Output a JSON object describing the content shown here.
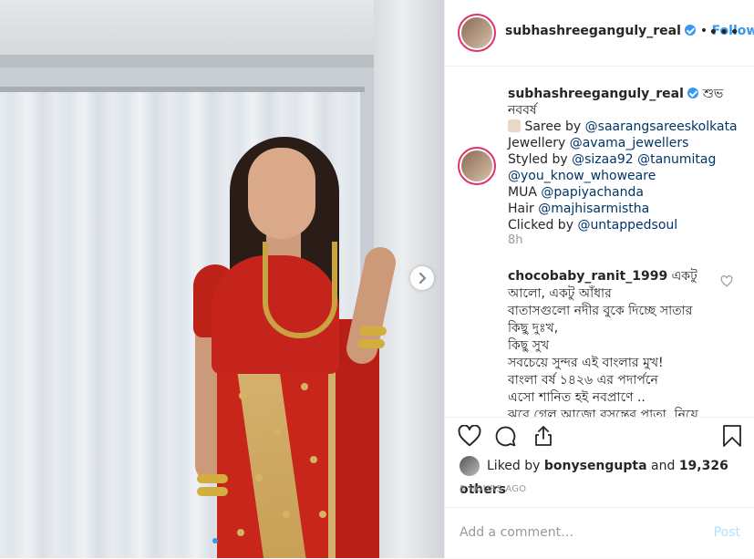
{
  "header": {
    "username": "subhashreeganguly_real",
    "separator": "•",
    "follow_label": "Follow",
    "more_label": "•••"
  },
  "caption": {
    "username": "subhashreeganguly_real",
    "title": "শুভ নববর্ষ",
    "lines": [
      {
        "label": "Saree by ",
        "link": "@saarangsareeskolkata"
      },
      {
        "label": "Jewellery ",
        "link": "@avama_jewellers"
      },
      {
        "label": "Styled by ",
        "link": "@sizaa92",
        "link2": "@tanumitag"
      },
      {
        "label": "",
        "link": "@you_know_whoweare"
      },
      {
        "label": "MUA ",
        "link": "@papiyachanda"
      },
      {
        "label": "Hair ",
        "link": "@majhisarmistha"
      },
      {
        "label": "Clicked by ",
        "link": "@untappedsoul"
      }
    ],
    "time": "8h"
  },
  "comment": {
    "username": "chocobaby_ranit_1999",
    "first": " একটু",
    "lines": [
      "আলো, একটু আঁধার",
      "বাতাসগুলো নদীর বুকে দিচ্ছে সাতার",
      "কিছু দুঃখ,",
      "কিছু সুখ",
      "সবচেয়ে সুন্দর এই বাংলার মুখ!",
      "বাংলা বর্ষ ১৪২৬ এর পদার্পনে",
      "এসো শানিত হই নবপ্রাণে ..",
      "ঝরে গেল আজো বসন্তের পাতা, নিয়ে"
    ]
  },
  "likes": {
    "prefix": "Liked by ",
    "user": "bonysengupta",
    "middle": " and ",
    "count": "19,326 others"
  },
  "timestamp": "8 HOURS AGO",
  "add_comment": {
    "placeholder": "Add a comment…",
    "post_label": "Post"
  },
  "colors": {
    "accent": "#3897f0",
    "link": "#003569",
    "muted": "#999999"
  },
  "icons": [
    "heart-icon",
    "comment-icon",
    "share-icon",
    "bookmark-icon",
    "verified-icon",
    "more-icon",
    "chevron-right-icon"
  ]
}
